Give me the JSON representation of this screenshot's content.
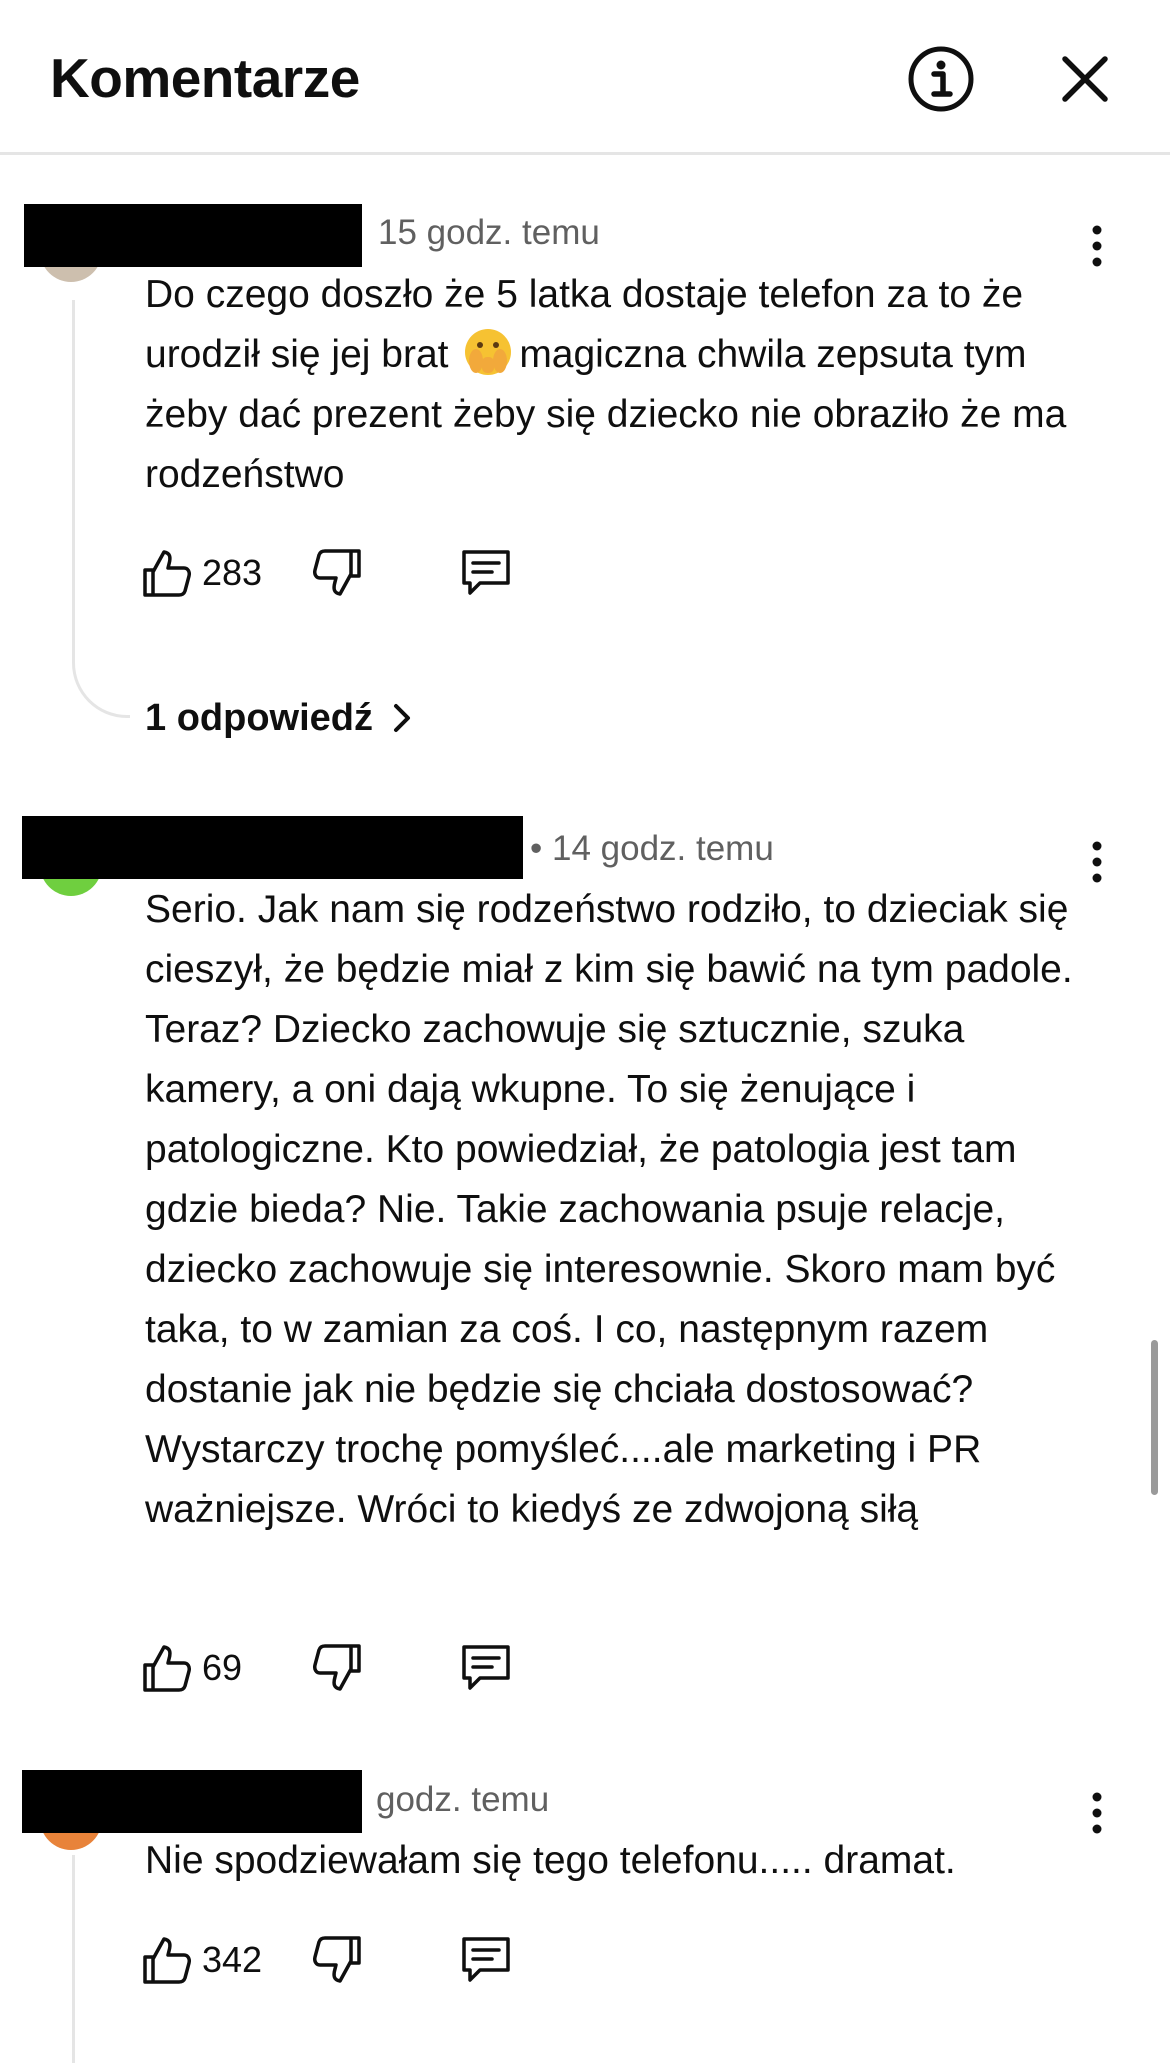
{
  "header": {
    "title": "Komentarze",
    "info_icon": "info-icon",
    "close_icon": "close-icon"
  },
  "comments": [
    {
      "time": "15 godz. temu",
      "text_before_emoji": "Do czego doszło że 5 latka dostaje telefon za to że urodził się jej brat ",
      "emoji": "face-with-open-eyes-and-hand-over-mouth",
      "text_after_emoji": "magiczna chwila zepsuta tym żeby dać prezent żeby się dziecko nie obraziło że ma rodzeństwo",
      "likes": "283",
      "replies_label": "1 odpowiedź"
    },
    {
      "time": "• 14 godz. temu",
      "text": "Serio. Jak nam się rodzeństwo rodziło, to dzieciak się cieszył, że będzie miał z kim się bawić na tym padole. Teraz? Dziecko zachowuje się sztucznie, szuka kamery, a oni dają wkupne. To się żenujące i patologiczne. Kto powiedział, że patologia jest tam gdzie bieda? Nie. Takie zachowania psuje relacje, dziecko zachowuje się interesownie. Skoro mam być taka, to w zamian za coś. I co, następnym razem dostanie jak nie będzie się chciała dostosować? Wystarczy trochę pomyśleć....ale marketing i PR ważniejsze. Wróci to kiedyś ze zdwojoną siłą",
      "likes": "69"
    },
    {
      "time": "godz. temu",
      "text": "Nie spodziewałam się tego telefonu..... dramat.",
      "likes": "342"
    }
  ],
  "colors": {
    "text": "#0f0f0f",
    "meta": "#606060",
    "divider": "#e5e5e5",
    "redaction": "#000000"
  }
}
